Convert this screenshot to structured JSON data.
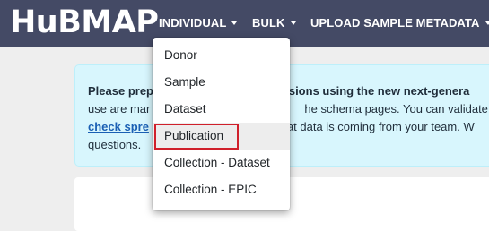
{
  "header": {
    "logo_text": "HuBMAP",
    "nav": [
      {
        "label": "INDIVIDUAL"
      },
      {
        "label": "BULK"
      },
      {
        "label": "UPLOAD SAMPLE METADATA"
      }
    ]
  },
  "alert": {
    "line1_bold_left": "Please prep",
    "line1_bold_right": "issions using the new next-genera",
    "line2_left": "use are mar",
    "line2_right": "he schema pages. You can validate",
    "line3_link": "check spre",
    "line3_right": "at data is coming from your team. W",
    "line4": "questions."
  },
  "dropdown": {
    "items": [
      {
        "label": "Donor"
      },
      {
        "label": "Sample"
      },
      {
        "label": "Dataset"
      },
      {
        "label": "Publication"
      },
      {
        "label": "Collection - Dataset"
      },
      {
        "label": "Collection - EPIC"
      }
    ],
    "highlighted_item": "Publication"
  },
  "colors": {
    "navbar": "#444a65",
    "alert_background": "#d8f6fd",
    "highlight_border": "#d0202b"
  }
}
